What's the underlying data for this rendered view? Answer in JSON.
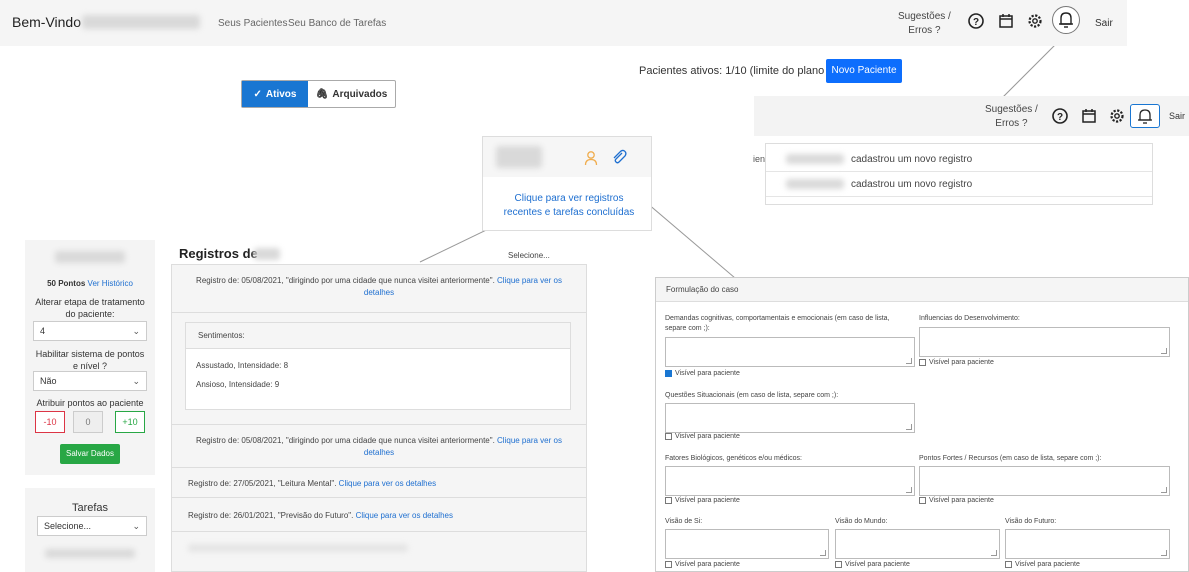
{
  "navbar": {
    "brand": "Bem-Vindo",
    "links": [
      "Seus Pacientes",
      "Seu Banco de Tarefas"
    ],
    "sugestoes": [
      "Sugestões /",
      "Erros ?"
    ],
    "sair": "Sair"
  },
  "patients": {
    "active_text": "Pacientes ativos: 1/10 (limite do plano atual)",
    "new_button": "Novo Paciente",
    "tab_ativos": "Ativos",
    "tab_arquivados": "Arquivados"
  },
  "notifications": {
    "sugestoes": [
      "Sugestões /",
      "Erros ?"
    ],
    "sair": "Sair",
    "partial_label": "ien",
    "items": [
      "cadastrou um novo registro",
      "cadastrou um novo registro"
    ]
  },
  "patient_card": {
    "link": "Clique para ver registros recentes e tarefas concluídas"
  },
  "sidebar": {
    "points_value": "50 Pontos",
    "points_history": "Ver Histórico",
    "stage_label": "Alterar etapa de tratamento do paciente:",
    "stage_value": "4",
    "points_system_label": "Habilitar sistema de pontos e nível ?",
    "points_system_value": "Não",
    "assign_label": "Atribuir pontos ao paciente",
    "minus": "-10",
    "zero": "0",
    "plus": "+10",
    "save": "Salvar Dados",
    "tasks_title": "Tarefas",
    "tasks_select": "Selecione..."
  },
  "registros": {
    "title": "Registros de",
    "select": "Selecione...",
    "rows": [
      {
        "text": "Registro de: 05/08/2021, \"dirigindo por uma cidade que nunca visitei anteriormente\".",
        "link": "Clique para ver os detalhes"
      },
      {
        "text": "Registro de: 05/08/2021, \"dirigindo por uma cidade que nunca visitei anteriormente\".",
        "link": "Clique para ver os detalhes"
      },
      {
        "text": "Registro de: 27/05/2021, \"Leitura Mental\".",
        "link": "Clique para ver os detalhes"
      },
      {
        "text": "Registro de: 26/01/2021, \"Previsão do Futuro\".",
        "link": "Clique para ver os detalhes"
      }
    ],
    "sentimentos_title": "Sentimentos:",
    "sentimentos": [
      "Assustado, Intensidade: 8",
      "Ansioso, Intensidade: 9"
    ]
  },
  "formulacao": {
    "title": "Formulação do caso",
    "field1": "Demandas cognitivas, comportamentais e emocionais (em caso de lista, separe com ;):",
    "field2": "Influencias do Desenvolvimento:",
    "field3": "Questões Situacionais (em caso de lista, separe com ;):",
    "field4": "Fatores Biológicos, genéticos e/ou médicos:",
    "field5": "Pontos Fortes / Recursos (em caso de lista, separe com ;):",
    "field6": "Visão de Si:",
    "field7": "Visão do Mundo:",
    "field8": "Visão do Futuro:",
    "visible": "Visível para paciente"
  },
  "colors": {
    "primary": "#1976d2",
    "link": "#1e6fd0",
    "success": "#28a745",
    "danger": "#dc3545"
  }
}
